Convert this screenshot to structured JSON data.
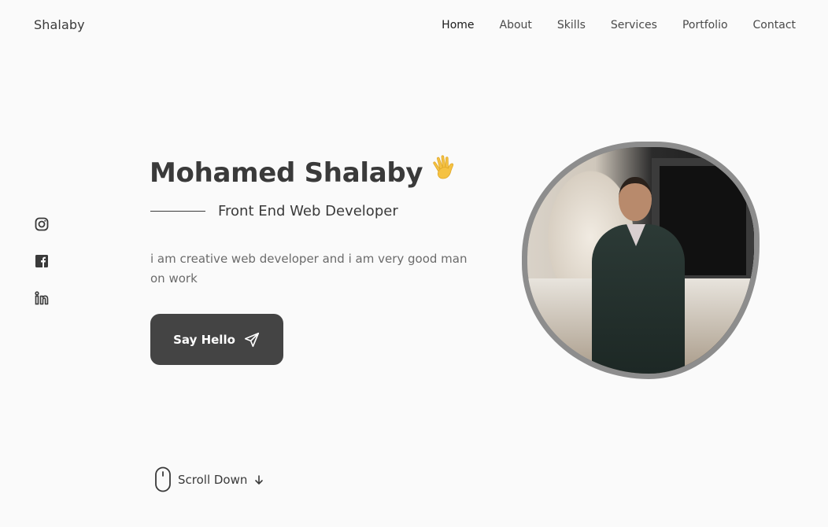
{
  "brand": {
    "logo": "Shalaby"
  },
  "nav": {
    "items": [
      {
        "label": "Home",
        "active": true
      },
      {
        "label": "About",
        "active": false
      },
      {
        "label": "Skills",
        "active": false
      },
      {
        "label": "Services",
        "active": false
      },
      {
        "label": "Portfolio",
        "active": false
      },
      {
        "label": "Contact",
        "active": false
      }
    ]
  },
  "social": {
    "icons": [
      "instagram-icon",
      "facebook-icon",
      "linkedin-icon"
    ]
  },
  "hero": {
    "name": "Mohamed Shalaby",
    "wave_icon": "waving-hand-icon",
    "subtitle": "Front End Web Developer",
    "description": "i am creative web developer and i am very good man on work",
    "cta_label": "Say Hello",
    "cta_icon": "send-icon"
  },
  "scroll": {
    "label": "Scroll Down",
    "mouse_icon": "mouse-icon",
    "arrow_icon": "arrow-down-icon"
  },
  "colors": {
    "background": "#fafafa",
    "text": "#3a3a3a",
    "muted": "#6b6b6b",
    "button": "#444444",
    "wave": "#f5c242"
  }
}
